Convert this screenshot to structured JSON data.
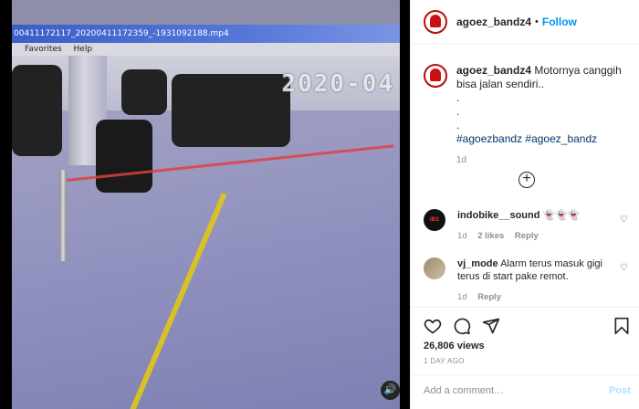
{
  "video": {
    "window_title": "00411172117_20200411172359_-1931092188.mp4",
    "menu": [
      "Favorites",
      "Help"
    ],
    "timestamp_overlay": "2020-04",
    "sound_icon": "speaker-icon"
  },
  "header": {
    "username": "agoez_bandz4",
    "separator": "•",
    "follow_label": "Follow",
    "more_icon": "more-icon"
  },
  "caption": {
    "username": "agoez_bandz4",
    "text": "Motornya canggih bisa jalan sendiri..",
    "dots": [
      ".",
      ".",
      "."
    ],
    "hashtags": "#agoezbandz #agoez_bandz",
    "age": "1d"
  },
  "load_more_icon": "plus-circle-icon",
  "comments": [
    {
      "username": "indobike__sound",
      "text": "👻👻👻",
      "age": "1d",
      "likes": "2 likes",
      "reply": "Reply",
      "avatar_text": "IBS"
    },
    {
      "username": "vj_mode",
      "text": "Alarm terus masuk gigi terus di start pake remot.",
      "age": "1d",
      "reply": "Reply"
    }
  ],
  "actions": {
    "icons": [
      "heart-icon",
      "comment-icon",
      "share-icon",
      "bookmark-icon"
    ],
    "views": "26,806 views",
    "date": "1 DAY AGO"
  },
  "add_comment": {
    "placeholder": "Add a comment…",
    "post_label": "Post"
  },
  "colors": {
    "link_blue": "#0095f6",
    "hashtag": "#00376b",
    "muted": "#8e8e8e",
    "post_disabled": "#b2dffc"
  }
}
